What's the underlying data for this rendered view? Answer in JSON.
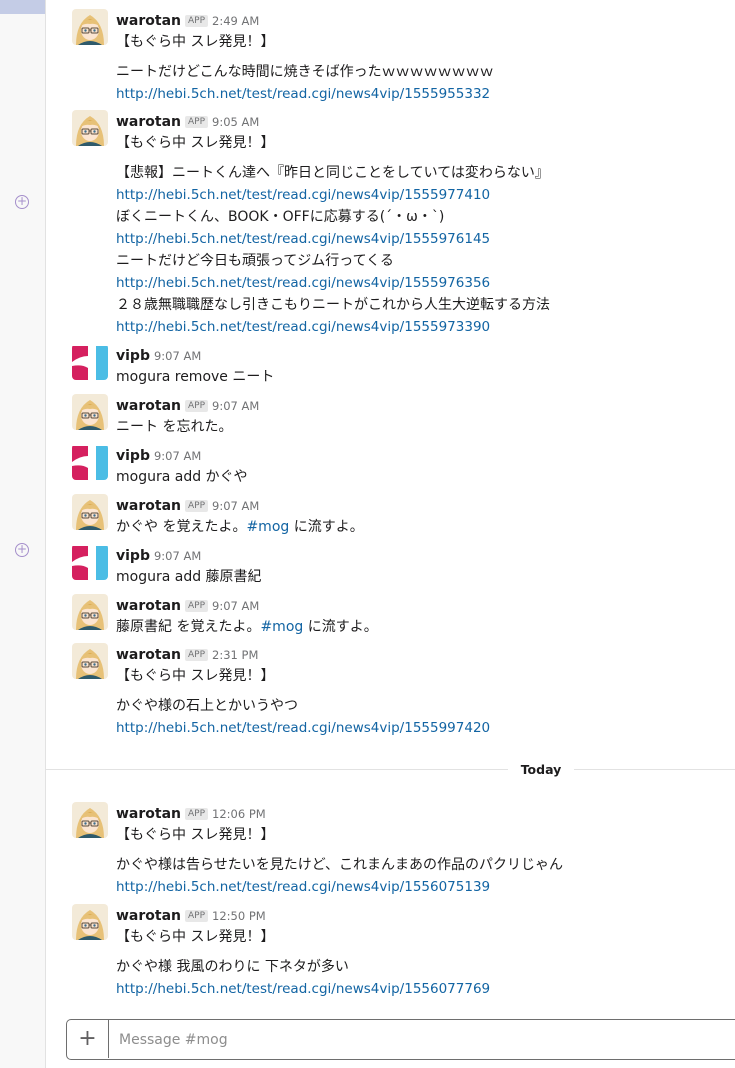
{
  "channel": {
    "composer_placeholder": "Message #mog",
    "composer_add": "+"
  },
  "divider": {
    "label": "Today"
  },
  "gutter": {
    "add_reaction_glyph": "+"
  },
  "badge_label": "APP",
  "messages": [
    {
      "author": "warotan",
      "app": true,
      "time": "2:49 AM",
      "title": "【もぐら中 スレ発見！】",
      "items": [
        {
          "text": "ニートだけどこんな時間に焼きそば作ったｗｗｗｗｗｗｗｗ",
          "url": "http://hebi.5ch.net/test/read.cgi/news4vip/1555955332"
        }
      ]
    },
    {
      "author": "warotan",
      "app": true,
      "time": "9:05 AM",
      "title": "【もぐら中 スレ発見！】",
      "items": [
        {
          "text": "【悲報】ニートくん達へ『昨日と同じことをしていては変わらない』",
          "url": "http://hebi.5ch.net/test/read.cgi/news4vip/1555977410"
        },
        {
          "text": "ぼくニートくん、BOOK・OFFに応募する(´・ω・`)",
          "url": "http://hebi.5ch.net/test/read.cgi/news4vip/1555976145"
        },
        {
          "text": "ニートだけど今日も頑張ってジム行ってくる",
          "url": "http://hebi.5ch.net/test/read.cgi/news4vip/1555976356"
        },
        {
          "text": "２８歳無職職歴なし引きこもりニートがこれから人生大逆転する方法",
          "url": "http://hebi.5ch.net/test/read.cgi/news4vip/1555973390"
        }
      ]
    },
    {
      "author": "vipb",
      "app": false,
      "time": "9:07 AM",
      "text": "mogura remove ニート"
    },
    {
      "author": "warotan",
      "app": true,
      "time": "9:07 AM",
      "text": "ニート を忘れた。"
    },
    {
      "author": "vipb",
      "app": false,
      "time": "9:07 AM",
      "text": "mogura add かぐや"
    },
    {
      "author": "warotan",
      "app": true,
      "time": "9:07 AM",
      "pre": "かぐや を覚えたよ。",
      "channel": "#mog",
      "post": " に流すよ。"
    },
    {
      "author": "vipb",
      "app": false,
      "time": "9:07 AM",
      "text": "mogura add 藤原書紀"
    },
    {
      "author": "warotan",
      "app": true,
      "time": "9:07 AM",
      "pre": "藤原書紀 を覚えたよ。",
      "channel": "#mog",
      "post": " に流すよ。"
    },
    {
      "author": "warotan",
      "app": true,
      "time": "2:31 PM",
      "title": "【もぐら中 スレ発見！】",
      "items": [
        {
          "text": "かぐや様の石上とかいうやつ",
          "url": "http://hebi.5ch.net/test/read.cgi/news4vip/1555997420"
        }
      ]
    },
    {
      "author": "warotan",
      "app": true,
      "time": "12:06 PM",
      "title": "【もぐら中 スレ発見！】",
      "items": [
        {
          "text": "かぐや様は告らせたいを見たけど、これまんまあの作品のパクリじゃん",
          "url": "http://hebi.5ch.net/test/read.cgi/news4vip/1556075139"
        }
      ]
    },
    {
      "author": "warotan",
      "app": true,
      "time": "12:50 PM",
      "title": "【もぐら中 スレ発見！】",
      "items": [
        {
          "text": "かぐや様 我風のわりに 下ネタが多い",
          "url": "http://hebi.5ch.net/test/read.cgi/news4vip/1556077769"
        }
      ]
    }
  ],
  "icons": {
    "warotan": "anime-girl-avatar-icon",
    "vipb": "vipb-logo-icon",
    "add_reaction": "add-reaction-icon"
  },
  "colors": {
    "link": "#1264a3",
    "vipb_red": "#d5205f",
    "vipb_blue": "#4bbde5",
    "reaction": "#a58fcb"
  }
}
